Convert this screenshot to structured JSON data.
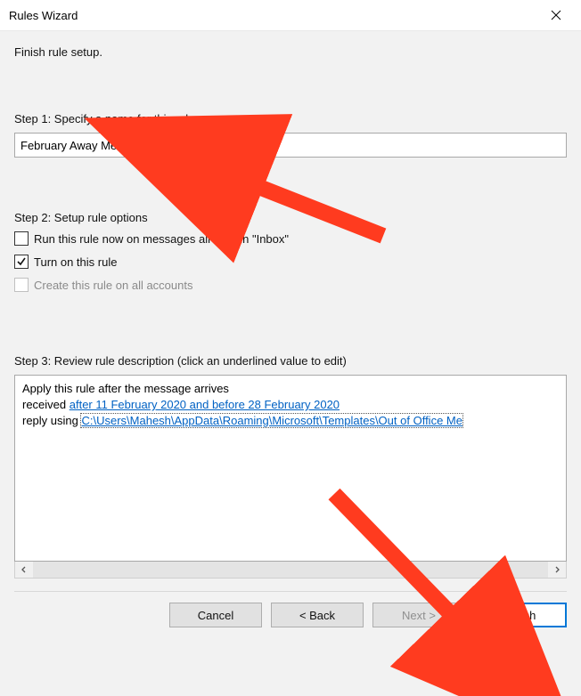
{
  "window": {
    "title": "Rules Wizard"
  },
  "instruction": "Finish rule setup.",
  "step1": {
    "label": "Step 1: Specify a name for this rule",
    "rule_name": "February Away Message"
  },
  "step2": {
    "label": "Step 2: Setup rule options",
    "opt_run_now": {
      "label": "Run this rule now on messages already in \"Inbox\"",
      "checked": false,
      "enabled": true
    },
    "opt_turn_on": {
      "label": "Turn on this rule",
      "checked": true,
      "enabled": true
    },
    "opt_all_accounts": {
      "label": "Create this rule on all accounts",
      "checked": false,
      "enabled": false
    }
  },
  "step3": {
    "label": "Step 3: Review rule description (click an underlined value to edit)",
    "line1": "Apply this rule after the message arrives",
    "line2_prefix": "received ",
    "line2_link": "after 11 February 2020 and before 28 February 2020",
    "line3_prefix": "reply using ",
    "line3_link": "C:\\Users\\Mahesh\\AppData\\Roaming\\Microsoft\\Templates\\Out of Office Me"
  },
  "buttons": {
    "cancel": "Cancel",
    "back": "< Back",
    "next": "Next >",
    "finish": "Finish"
  },
  "annotations": {
    "arrow_color": "#ff3b1f"
  }
}
